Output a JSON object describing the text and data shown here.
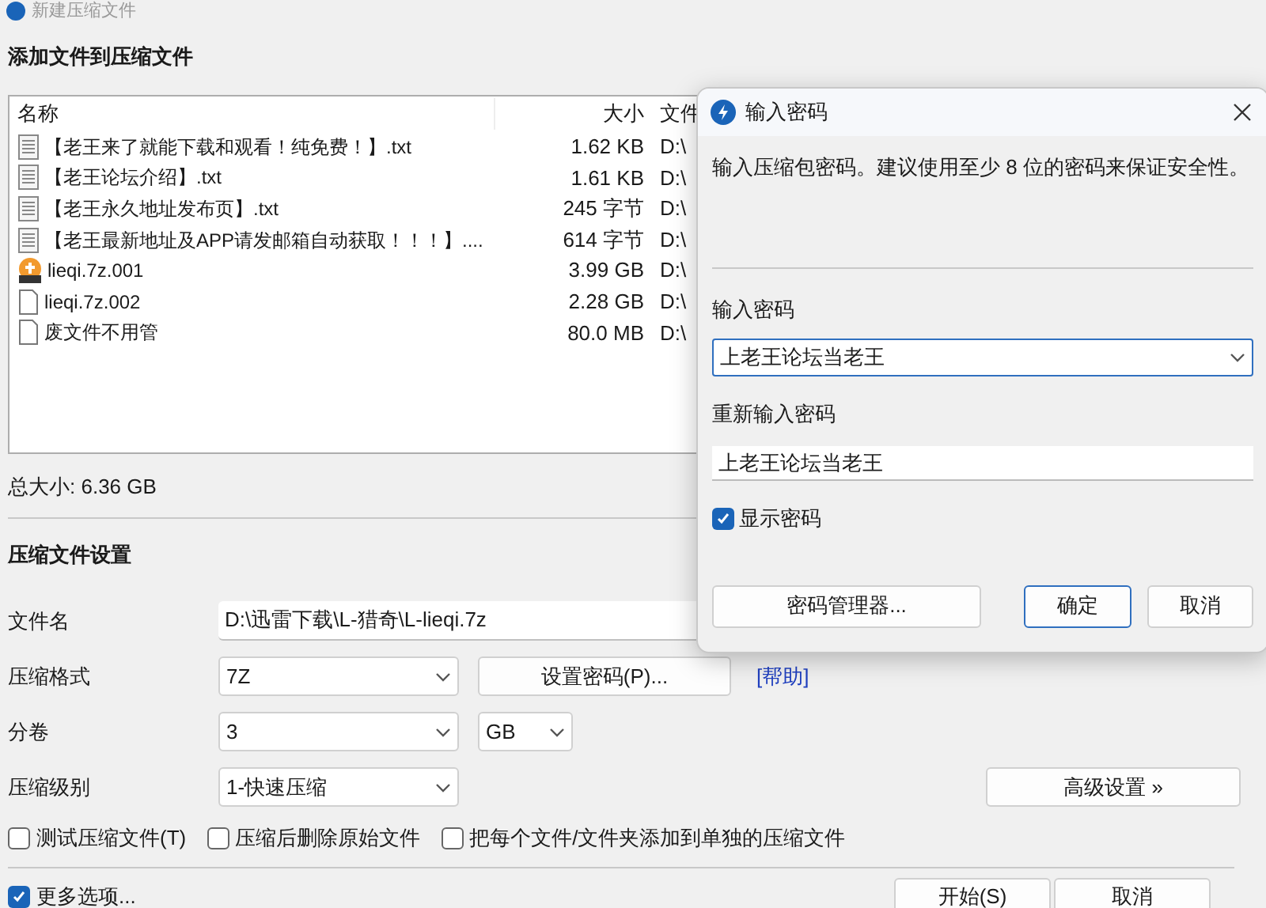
{
  "window": {
    "title": "新建压缩文件"
  },
  "add_files": {
    "heading": "添加文件到压缩文件",
    "columns": [
      "名称",
      "大小",
      "文件"
    ],
    "rows": [
      {
        "kind": "text",
        "name": "【老王来了就能下载和观看！纯免费！】.txt",
        "size": "1.62 KB",
        "column_3": "D:\\"
      },
      {
        "kind": "text",
        "name": "【老王论坛介绍】.txt",
        "size": "1.61 KB",
        "column_3": "D:\\"
      },
      {
        "kind": "text",
        "name": "【老王永久地址发布页】.txt",
        "size": "245 字节",
        "column_3": "D:\\"
      },
      {
        "kind": "text",
        "name": "【老王最新地址及APP请发邮箱自动获取！！！】....",
        "size": "614 字节",
        "column_3": "D:\\"
      },
      {
        "kind": "archive",
        "name": "lieqi.7z.001",
        "size": "3.99 GB",
        "column_3": "D:\\"
      },
      {
        "kind": "blank",
        "name": "lieqi.7z.002",
        "size": "2.28 GB",
        "column_3": "D:\\"
      },
      {
        "kind": "blank",
        "name": "废文件不用管",
        "size": "80.0 MB",
        "column_3": "D:\\"
      }
    ],
    "total_size": "总大小: 6.36 GB"
  },
  "settings": {
    "heading": "压缩文件设置",
    "file_name": {
      "label": "文件名",
      "value": "D:\\迅雷下载\\L-猎奇\\L-lieqi.7z"
    },
    "format": {
      "label": "压缩格式",
      "value": "7Z"
    },
    "set_password_button": "设置密码(P)...",
    "help_link": "[帮助]",
    "volume": {
      "label": "分卷",
      "value": "3",
      "unit": "GB"
    },
    "level": {
      "label": "压缩级别",
      "value": "1-快速压缩"
    },
    "advanced_button": "高级设置 »",
    "options": [
      {
        "label": "测试压缩文件(T)",
        "checked": false
      },
      {
        "label": "压缩后删除原始文件",
        "checked": false
      },
      {
        "label": "把每个文件/文件夹添加到单独的压缩文件",
        "checked": false
      }
    ]
  },
  "footer": {
    "more_options": {
      "label": "更多选项...",
      "checked": true
    },
    "buttons": [
      "开始(S)",
      "取消"
    ]
  },
  "password_dialog": {
    "title": "输入密码",
    "description": "输入压缩包密码。建议使用至少 8 位的密码来保证安全性。",
    "password": {
      "label": "输入密码",
      "value": "上老王论坛当老王"
    },
    "confirm": {
      "label": "重新输入密码",
      "value": "上老王论坛当老王"
    },
    "show_password": {
      "label": "显示密码",
      "checked": true
    },
    "buttons": [
      {
        "kind": "wide",
        "label": "密码管理器...",
        "default": false
      },
      {
        "kind": "normal",
        "label": "确定",
        "default": true
      },
      {
        "kind": "normal",
        "label": "取消",
        "default": false
      }
    ]
  }
}
